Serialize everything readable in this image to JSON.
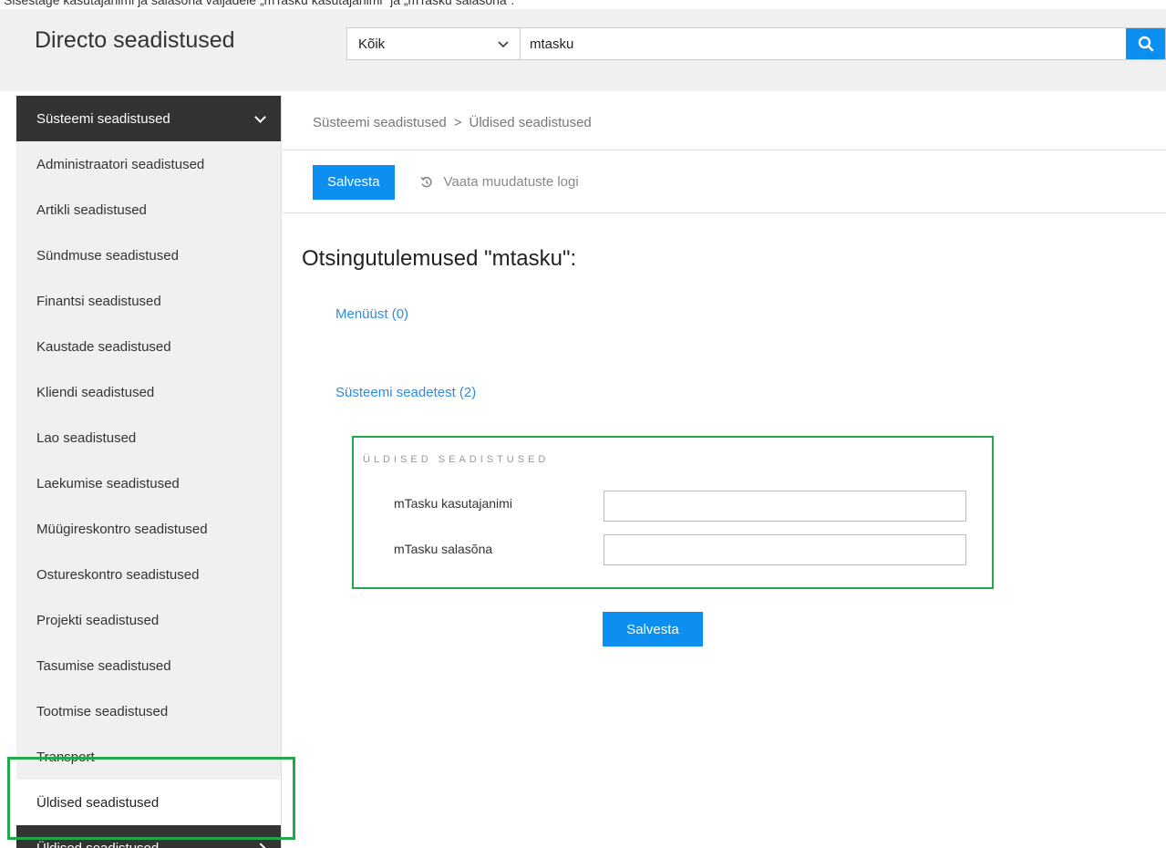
{
  "top_strip_text": "Sisestage kasutajanimi ja salasõna väljadele „mTasku kasutajanimi“ ja „mTasku salasõna“.",
  "app": {
    "title": "Directo seadistused"
  },
  "search": {
    "scope_value": "Kõik",
    "query_value": "mtasku",
    "icon": "search-icon"
  },
  "sidebar": {
    "header_label": "Süsteemi seadistused",
    "items": [
      "Administraatori seadistused",
      "Artikli seadistused",
      "Sündmuse seadistused",
      "Finantsi seadistused",
      "Kaustade seadistused",
      "Kliendi seadistused",
      "Lao seadistused",
      "Laekumise seadistused",
      "Müügireskontro seadistused",
      "Ostureskontro seadistused",
      "Projekti seadistused",
      "Tasumise seadistused",
      "Tootmise seadistused",
      "Transport",
      "Üldised seadistused"
    ],
    "active_item": "Üldised seadistused",
    "footer_label": "Üldised seadistused"
  },
  "breadcrumb": {
    "parent": "Süsteemi seadistused",
    "separator": ">",
    "current": "Üldised seadistused"
  },
  "toolbar": {
    "save_label": "Salvesta",
    "log_label": "Vaata muudatuste logi",
    "log_icon": "history-icon"
  },
  "results": {
    "title": "Otsingutulemused \"mtasku\":",
    "menu_link": "Menüüst (0)",
    "system_link": "Süsteemi seadetest (2)"
  },
  "card": {
    "title": "ÜLDISED SEADISTUSED",
    "fields": [
      {
        "label": "mTasku kasutajanimi",
        "value": ""
      },
      {
        "label": "mTasku salasõna",
        "value": ""
      }
    ]
  },
  "save_bottom_label": "Salvesta",
  "colors": {
    "accent": "#0d8ff2",
    "link": "#2d8ce0",
    "highlight": "#22a84a",
    "sidebar_dark": "#333333"
  }
}
